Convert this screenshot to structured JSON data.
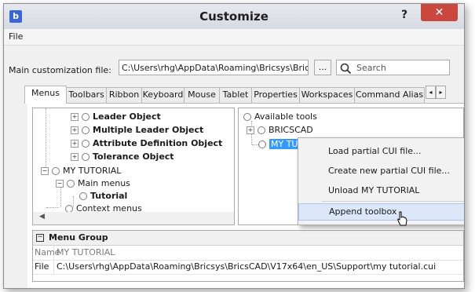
{
  "window": {
    "title": "Customize",
    "help_label": "?",
    "close_label": "✕"
  },
  "menu": {
    "file": "File"
  },
  "main_file": {
    "label": "Main customization file:",
    "value": "C:\\Users\\rhg\\AppData\\Roaming\\Bricsys\\BricsCAI",
    "browse_label": "..."
  },
  "search": {
    "placeholder": "Search"
  },
  "tabs": [
    "Menus",
    "Toolbars",
    "Ribbon",
    "Keyboard",
    "Mouse",
    "Tablet",
    "Properties",
    "Workspaces",
    "Command Alias"
  ],
  "tab_scroll": {
    "left": "◂",
    "right": "▸"
  },
  "left_tree": [
    {
      "label": "Leader Object",
      "bold": true
    },
    {
      "label": "Multiple Leader Object",
      "bold": true
    },
    {
      "label": "Attribute Definition Object",
      "bold": true
    },
    {
      "label": "Tolerance Object",
      "bold": true
    },
    {
      "label": "MY TUTORIAL",
      "bold": false
    },
    {
      "label": "Main menus",
      "bold": false
    },
    {
      "label": "Tutorial",
      "bold": true
    },
    {
      "label": "Context menus",
      "bold": false
    }
  ],
  "right_tree": [
    {
      "label": "Available tools"
    },
    {
      "label": "BRICSCAD"
    },
    {
      "label": "MY TUTORIAL"
    }
  ],
  "context_menu": [
    {
      "label": "Load partial CUI file..."
    },
    {
      "label": "Create new partial CUI file..."
    },
    {
      "label": "Unload MY TUTORIAL"
    },
    {
      "label": "Append toolbox"
    }
  ],
  "properties": {
    "section": "Menu Group",
    "collapse_label": "−",
    "rows": [
      {
        "key": "Name",
        "value": "MY TUTORIAL"
      },
      {
        "key": "File",
        "value": "C:\\Users\\rhg\\AppData\\Roaming\\Bricsys\\BricsCAD\\V17x64\\en_US\\Support\\my tutorial.cui"
      }
    ]
  },
  "icons": {
    "app": "bricscad-logo-icon",
    "search": "magnifier-icon"
  },
  "colors": {
    "close_button": "#c9473c",
    "selection": "#3399ff",
    "menu_hover": "#dbe7f8"
  }
}
